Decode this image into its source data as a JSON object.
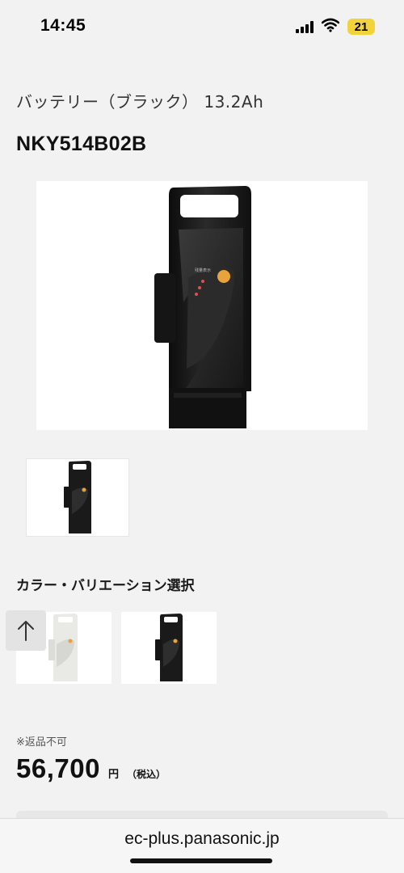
{
  "status_bar": {
    "time": "14:45",
    "battery": "21",
    "icons": [
      "signal-icon",
      "wifi-icon",
      "battery-icon"
    ]
  },
  "product": {
    "name": "バッテリー（ブラック） 13.2Ah",
    "code": "NKY514B02B",
    "image_icon": "battery-pack-image",
    "battery_label": "残量表示"
  },
  "variations": {
    "title": "カラー・バリエーション選択",
    "options": [
      {
        "color": "white",
        "icon": "white-battery-image"
      },
      {
        "color": "black",
        "icon": "black-battery-image"
      }
    ]
  },
  "scroll_top": {
    "icon": "arrow-up-icon"
  },
  "pricing": {
    "notice": "※返品不可",
    "price": "56,700",
    "unit": "円",
    "tax": "（税込）"
  },
  "browser": {
    "url": "ec-plus.panasonic.jp"
  },
  "colors": {
    "background": "#f2f2f2",
    "battery_body": "#1b1b1b",
    "accent_orange": "#e8a33a",
    "battery_badge": "#f3d33a"
  }
}
